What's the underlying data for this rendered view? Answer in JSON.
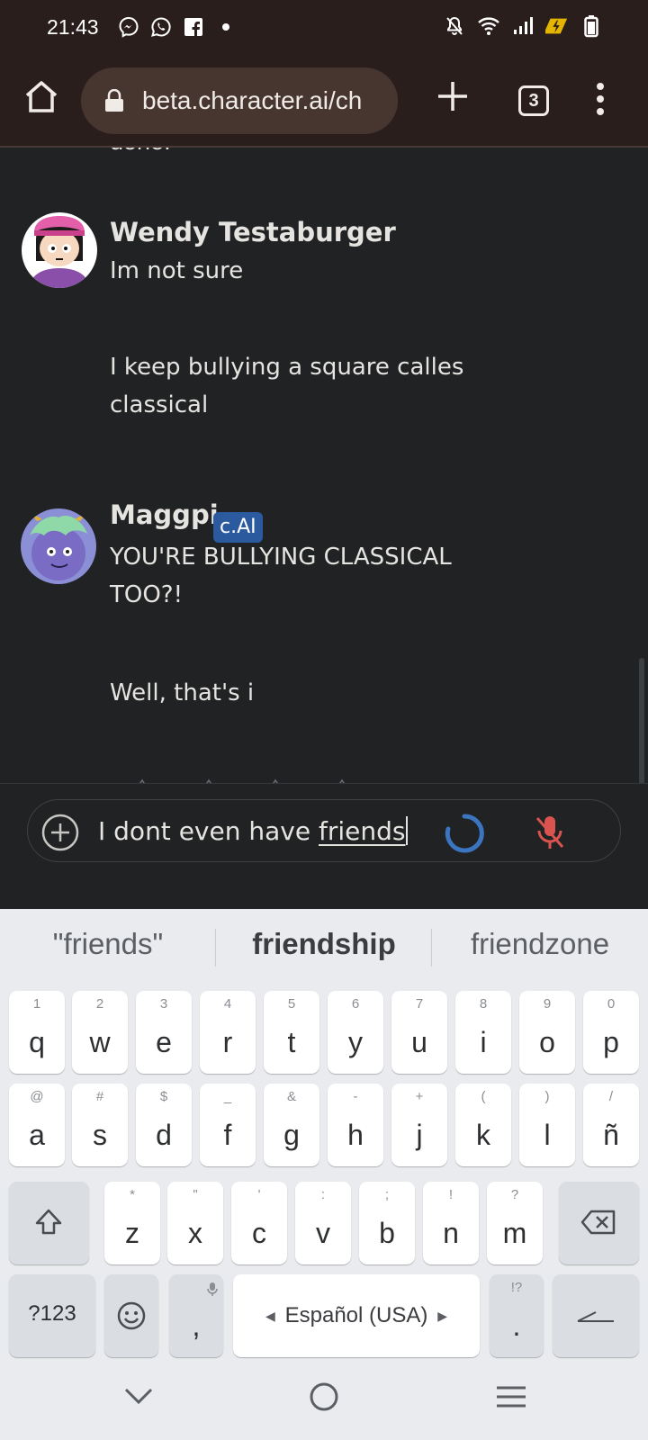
{
  "status_bar": {
    "time": "21:43",
    "left_icons": [
      "messenger-icon",
      "whatsapp-icon",
      "facebook-icon",
      "dot-icon"
    ],
    "right_icons": [
      "muted-bell-icon",
      "wifi-icon",
      "signal-icon",
      "battery-saver-icon",
      "battery-icon"
    ]
  },
  "browser": {
    "url": "beta.character.ai/ch",
    "tab_count": "3"
  },
  "chat": {
    "cut_off_text": "done.",
    "messages": [
      {
        "author": "Wendy Testaburger",
        "paragraphs": [
          "Im not sure",
          "I keep bullying a square calles classical"
        ]
      },
      {
        "author": "Maggpi",
        "badge": "c.AI",
        "paragraphs": [
          "YOU'RE BULLYING CLASSICAL TOO?!",
          "Well, that's i"
        ]
      }
    ]
  },
  "input": {
    "text_before": "I dont even have ",
    "text_underlined": "friends"
  },
  "keyboard": {
    "suggestions": [
      "\"friends\"",
      "friendship",
      "friendzone"
    ],
    "row1": [
      {
        "k": "q",
        "s": "1"
      },
      {
        "k": "w",
        "s": "2"
      },
      {
        "k": "e",
        "s": "3"
      },
      {
        "k": "r",
        "s": "4"
      },
      {
        "k": "t",
        "s": "5"
      },
      {
        "k": "y",
        "s": "6"
      },
      {
        "k": "u",
        "s": "7"
      },
      {
        "k": "i",
        "s": "8"
      },
      {
        "k": "o",
        "s": "9"
      },
      {
        "k": "p",
        "s": "0"
      }
    ],
    "row2": [
      {
        "k": "a",
        "s": "@"
      },
      {
        "k": "s",
        "s": "#"
      },
      {
        "k": "d",
        "s": "$"
      },
      {
        "k": "f",
        "s": "_"
      },
      {
        "k": "g",
        "s": "&"
      },
      {
        "k": "h",
        "s": "-"
      },
      {
        "k": "j",
        "s": "+"
      },
      {
        "k": "k",
        "s": "("
      },
      {
        "k": "l",
        "s": ")"
      },
      {
        "k": "ñ",
        "s": "/"
      }
    ],
    "row3": [
      {
        "k": "z",
        "s": "*"
      },
      {
        "k": "x",
        "s": "\""
      },
      {
        "k": "c",
        "s": "'"
      },
      {
        "k": "v",
        "s": ":"
      },
      {
        "k": "b",
        "s": ";"
      },
      {
        "k": "n",
        "s": "!"
      },
      {
        "k": "m",
        "s": "?"
      }
    ],
    "symbols_key": "?123",
    "comma_key": ",",
    "space_label": "Español (USA)",
    "period_key": ".",
    "period_sub": "!?"
  }
}
